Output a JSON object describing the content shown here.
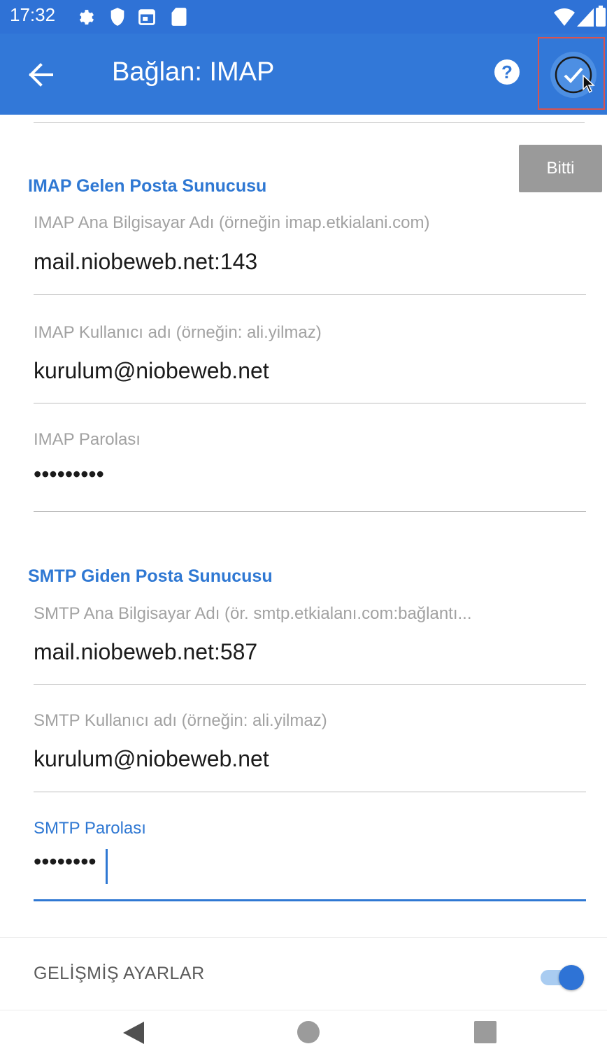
{
  "status_bar": {
    "time": "17:32",
    "left_icons": [
      "gear-icon",
      "shield-icon",
      "calendar-icon",
      "sd-card-icon"
    ],
    "right_icons": [
      "wifi-icon",
      "cell-signal-icon",
      "battery-icon"
    ]
  },
  "app_bar": {
    "title": "Bağlan: IMAP",
    "back_icon": "arrow-left-icon",
    "help_icon": "help-circle-icon",
    "confirm_icon": "check-icon",
    "color": "#3278d8"
  },
  "keyboard_action": {
    "done_label": "Bitti"
  },
  "imap": {
    "section_title": "IMAP Gelen Posta Sunucusu",
    "host": {
      "label": "IMAP Ana Bilgisayar Adı (örneğin imap.etkialani.com)",
      "value": "mail.niobeweb.net:143"
    },
    "username": {
      "label": "IMAP Kullanıcı adı (örneğin: ali.yilmaz)",
      "value": "kurulum@niobeweb.net"
    },
    "password": {
      "label": "IMAP Parolası",
      "value": "•••••••••"
    }
  },
  "smtp": {
    "section_title": "SMTP Giden Posta Sunucusu",
    "host": {
      "label": "SMTP Ana Bilgisayar Adı (ör. smtp.etkialanı.com:bağlantı...",
      "value": "mail.niobeweb.net:587"
    },
    "username": {
      "label": "SMTP Kullanıcı adı (örneğin: ali.yilmaz)",
      "value": "kurulum@niobeweb.net"
    },
    "password": {
      "label": "SMTP Parolası",
      "value": "••••••••"
    }
  },
  "advanced": {
    "label": "GELİŞMİŞ AYARLAR",
    "enabled": true
  },
  "nav_bar": {
    "icons": [
      "back-triangle-icon",
      "home-circle-icon",
      "recents-square-icon"
    ]
  },
  "colors": {
    "accent": "#2f78d3",
    "status_bar": "#2f72d6",
    "highlight": "#d9534f"
  }
}
